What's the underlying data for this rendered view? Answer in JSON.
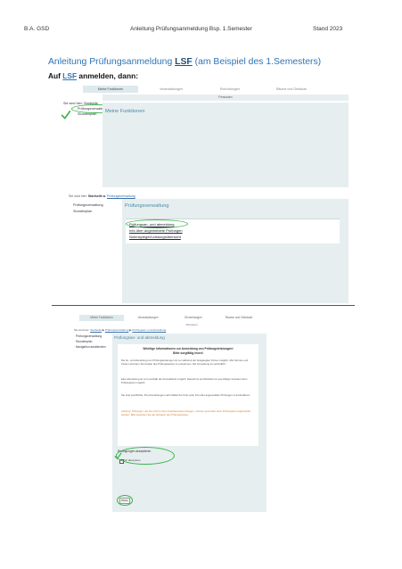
{
  "header": {
    "left": "B.A. GSD",
    "center": "Anleitung Prüfungsanmeldung Bsp. 1.Semester",
    "right": "Stand 2023"
  },
  "title": {
    "prefix": "Anleitung Prüfungsanmeldung ",
    "lsf": "LSF",
    "suffix": " (am Beispiel des 1.Semesters)"
  },
  "subtitle": {
    "prefix": "Auf ",
    "lsf": "LSF",
    "suffix": " anmelden, dann:"
  },
  "screenshot1": {
    "nav_tabs": [
      "Meine Funktionen",
      "Veranstaltungen",
      "Einrichtungen",
      "Räume und Gebäude"
    ],
    "subnav": "Personen",
    "left_links": [
      "Sie sind hier: Startseite",
      "Prüfungsverwaltung",
      "Stundenplan"
    ],
    "top_title": "Meine Funktionen",
    "breadcrumb": {
      "prefix": "Sie sind hier: ",
      "start": "Startseite",
      "sep": " ▶ ",
      "current": "Prüfungsverwaltung"
    },
    "side_links": [
      "Prüfungsverwaltung",
      "Stundenplan"
    ],
    "bottom_title": "Prüfungsverwaltung",
    "links": [
      "Prüfungsan- und abmeldung",
      "Info über angemeldete Prüfungen",
      "Notenspiegel/Leistungsübersicht"
    ]
  },
  "screenshot2": {
    "nav_tabs": [
      "Meine Funktionen",
      "Veranstaltungen",
      "Einrichtungen",
      "Räume und Gebäude"
    ],
    "subnav": "Personen",
    "breadcrumb": {
      "prefix": "Sie sind hier: ",
      "start": "Startseite",
      "sep1": " ▶ ",
      "mid": "Prüfungsverwaltung",
      "sep2": " ▶ ",
      "current": "Prüfungsan- und abmeldung"
    },
    "side_links": [
      "Prüfungsverwaltung",
      "Stundenplan",
      "Navigation ausblenden"
    ],
    "title": "Prüfungsan- und abmeldung",
    "box_heading_1": "Wichtige Informationen zur Anmeldung von Prüfungsleistungen!",
    "box_heading_2": "Bitte sorgfältig lesen!",
    "para1": "Die An- und Abmeldung von Prüfungsleistungen ist nur während der festgelegten Fristen möglich. Alle Termine und Fristen sind dem Terminplan des Prüfungsamtes zu entnehmen. Die Anmeldung ist verbindlich.",
    "para2": "Eine Abmeldung ist nur innerhalb der Anmeldefrist möglich. Danach ist ein Rücktritt nur aus triftigen Gründen beim Prüfungsamt möglich.",
    "para3": "Sie sind verpflichtet, Ihre Anmeldungen nach Ablauf der Frist unter Info über angemeldete Prüfungen zu kontrollieren.",
    "para4": "Achtung: Prüfungen, die Sie nicht in Ihrem Fachsemester belegen, müssen gesondert beim Prüfungsamt angemeldet werden. Bitte beachten Sie die Hinweise des Prüfungsamtes.",
    "checkbox_heading": "Bedingungen akzeptieren",
    "checkbox_label": "Ich akzeptiere",
    "button": "Weiter"
  }
}
